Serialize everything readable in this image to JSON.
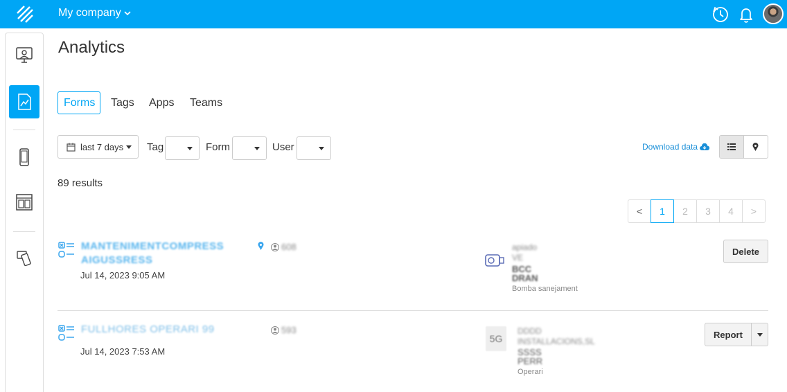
{
  "header": {
    "company": "My company",
    "icons": [
      "logo-icon",
      "history-icon",
      "bell-icon",
      "avatar"
    ]
  },
  "sidebar": {
    "items": [
      {
        "name": "monitor",
        "icon": "monitor-user-icon",
        "active": false
      },
      {
        "name": "analytics",
        "icon": "chart-document-icon",
        "active": true
      },
      {
        "name": "mobile",
        "icon": "phone-icon",
        "active": false
      },
      {
        "name": "layout",
        "icon": "layout-icon",
        "active": false
      },
      {
        "name": "devices",
        "icon": "devices-icon",
        "active": false
      }
    ]
  },
  "page": {
    "title": "Analytics"
  },
  "tabs": [
    {
      "label": "Forms",
      "active": true
    },
    {
      "label": "Tags",
      "active": false
    },
    {
      "label": "Apps",
      "active": false
    },
    {
      "label": "Teams",
      "active": false
    }
  ],
  "filters": {
    "date": "last 7 days",
    "tag_label": "Tag",
    "form_label": "Form",
    "user_label": "User"
  },
  "download": {
    "label": "Download data"
  },
  "results": {
    "count_text": "89 results"
  },
  "pagination": {
    "prev": "<",
    "pages": [
      "1",
      "2",
      "3",
      "4"
    ],
    "current": "1",
    "next": ">"
  },
  "rows": [
    {
      "title_line1": "MANTENIMENTCOMPRESS",
      "title_line2": "AIGUSSRESS",
      "date": "Jul 14, 2023 9:05 AM",
      "user": "608",
      "asset_line1": "apiado",
      "asset_line2": "VE",
      "asset_line3": "BCC",
      "asset_line4": "DRAN",
      "asset_sub": "Bomba sanejament",
      "action": "Delete"
    },
    {
      "title_line1": "FULLHORES OPERARI 99",
      "date": "Jul 14, 2023 7:53 AM",
      "user": "593",
      "asset_label": "5G",
      "asset_line1": "DDDD",
      "asset_line2": "INSTALLACIONS,SL",
      "asset_line3": "SSSS",
      "asset_line4": "PERR",
      "asset_sub": "Operari",
      "action": "Report"
    }
  ],
  "colors": {
    "primary": "#00a6f5",
    "link": "#1a8fd8",
    "text": "#333333"
  }
}
